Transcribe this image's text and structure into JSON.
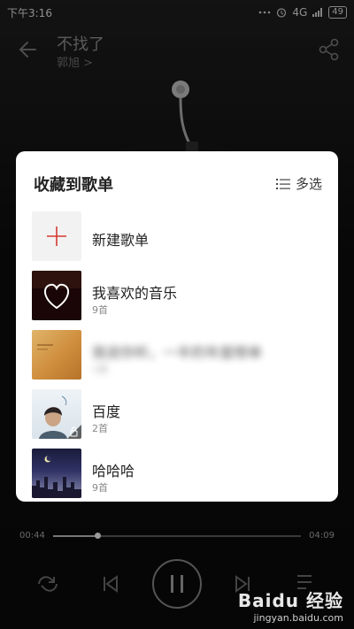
{
  "status_bar": {
    "time": "下午3:16",
    "network": "4G",
    "battery": "49"
  },
  "player": {
    "song_title": "不找了",
    "artist": "郭旭 >",
    "current_time": "00:44",
    "total_time": "04:09",
    "progress": 0.18
  },
  "collect_sheet": {
    "title": "收藏到歌单",
    "multi_select_label": "多选",
    "new_playlist_label": "新建歌单",
    "playlists": [
      {
        "name": "我喜欢的音乐",
        "count": "9首",
        "cover": "heart-cover"
      },
      {
        "name": "我说你听，一半的年度榜单",
        "count": "1首",
        "cover": "album-cover",
        "blurred": true
      },
      {
        "name": "百度",
        "count": "2首",
        "cover": "baidu-cover"
      },
      {
        "name": "哈哈哈",
        "count": "9首",
        "cover": "night-cover"
      }
    ]
  },
  "watermark": {
    "brand": "Baidu 经验",
    "url": "jingyan.baidu.com"
  },
  "colors": {
    "accent_red": "#d33a31",
    "sheet_bg": "#ffffff"
  }
}
